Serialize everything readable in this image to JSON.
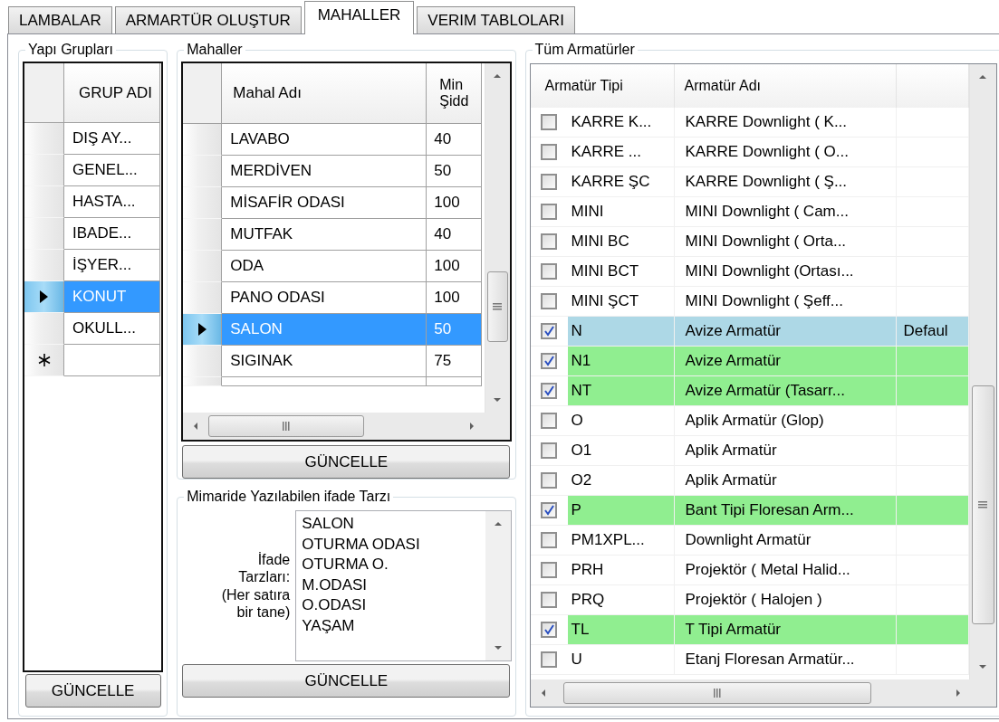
{
  "tabs": [
    {
      "label": "LAMBALAR",
      "selected": false
    },
    {
      "label": "ARMARTÜR OLUŞTUR",
      "selected": false
    },
    {
      "label": "MAHALLER",
      "selected": true
    },
    {
      "label": "VERIM TABLOLARI",
      "selected": false
    }
  ],
  "building_groups": {
    "title": "Yapı Grupları",
    "columns": [
      "GRUP ADI"
    ],
    "rows": [
      {
        "cells": [
          "DIŞ AY..."
        ],
        "selected": false
      },
      {
        "cells": [
          "GENEL..."
        ],
        "selected": false
      },
      {
        "cells": [
          "HASTA..."
        ],
        "selected": false
      },
      {
        "cells": [
          "IBADE..."
        ],
        "selected": false
      },
      {
        "cells": [
          "İŞYER..."
        ],
        "selected": false
      },
      {
        "cells": [
          "KONUT"
        ],
        "selected": true
      },
      {
        "cells": [
          "OKULL..."
        ],
        "selected": false
      }
    ],
    "new_row": true,
    "button": "GÜNCELLE"
  },
  "spaces": {
    "title": "Mahaller",
    "columns": [
      "Mahal Adı",
      "Min\nŞidd"
    ],
    "rows": [
      {
        "cells": [
          "LAVABO",
          "40"
        ],
        "selected": false
      },
      {
        "cells": [
          "MERDİVEN",
          "50"
        ],
        "selected": false
      },
      {
        "cells": [
          "MİSAFİR ODASI",
          "100"
        ],
        "selected": false
      },
      {
        "cells": [
          "MUTFAK",
          "40"
        ],
        "selected": false
      },
      {
        "cells": [
          "ODA",
          "100"
        ],
        "selected": false
      },
      {
        "cells": [
          "PANO ODASI",
          "100"
        ],
        "selected": false
      },
      {
        "cells": [
          "SALON",
          "50"
        ],
        "selected": true
      },
      {
        "cells": [
          "SIGINAK",
          "75"
        ],
        "selected": false
      }
    ],
    "button": "GÜNCELLE"
  },
  "expressions": {
    "title": "Mimaride Yazılabilen ifade Tarzı",
    "label": "İfade\nTarzları:\n(Her satıra\nbir tane)",
    "lines": [
      "SALON",
      "OTURMA ODASI",
      "OTURMA O.",
      "M.ODASI",
      "O.ODASI",
      "YAŞAM"
    ],
    "button": "GÜNCELLE"
  },
  "fixtures": {
    "title": "Tüm Armatürler",
    "columns": [
      "Armatür Tipi",
      "Armatür Adı"
    ],
    "rows": [
      {
        "checked": false,
        "type": "KARRE K...",
        "name": "KARRE Downlight ( K...",
        "color": "#ffffff"
      },
      {
        "checked": false,
        "type": "KARRE ...",
        "name": "KARRE Downlight ( O...",
        "color": "#ffffff"
      },
      {
        "checked": false,
        "type": "KARRE ŞC",
        "name": "KARRE Downlight ( Ş...",
        "color": "#ffffff"
      },
      {
        "checked": false,
        "type": "MINI",
        "name": "MINI Downlight ( Cam...",
        "color": "#ffffff"
      },
      {
        "checked": false,
        "type": "MINI BC",
        "name": "MINI Downlight ( Orta...",
        "color": "#ffffff"
      },
      {
        "checked": false,
        "type": "MINI BCT",
        "name": "MINI Downlight (Ortası...",
        "color": "#ffffff"
      },
      {
        "checked": false,
        "type": "MINI ŞCT",
        "name": "MINI Downlight ( Şeff...",
        "color": "#ffffff"
      },
      {
        "checked": true,
        "type": "N",
        "name": "Avize Armatür",
        "column_3": "Defaul",
        "color": "#add8e6"
      },
      {
        "checked": true,
        "type": "N1",
        "name": "Avize Armatür",
        "color": "#90ee90"
      },
      {
        "checked": true,
        "type": "NT",
        "name": "Avize Armatür (Tasarr...",
        "color": "#90ee90"
      },
      {
        "checked": false,
        "type": "O",
        "name": "Aplik Armatür (Glop)",
        "color": "#ffffff"
      },
      {
        "checked": false,
        "type": "O1",
        "name": "Aplik Armatür",
        "color": "#ffffff"
      },
      {
        "checked": false,
        "type": "O2",
        "name": "Aplik Armatür",
        "color": "#ffffff"
      },
      {
        "checked": true,
        "type": "P",
        "name": "Bant Tipi Floresan Arm...",
        "color": "#90ee90"
      },
      {
        "checked": false,
        "type": "PM1XPL...",
        "name": "Downlight Armatür",
        "color": "#ffffff"
      },
      {
        "checked": false,
        "type": "PRH",
        "name": "Projektör ( Metal Halid...",
        "color": "#ffffff"
      },
      {
        "checked": false,
        "type": "PRQ",
        "name": "Projektör ( Halojen )",
        "color": "#ffffff"
      },
      {
        "checked": true,
        "type": "TL",
        "name": "T Tipi Armatür",
        "color": "#90ee90"
      },
      {
        "checked": false,
        "type": "U",
        "name": "Etanj Floresan Armatür...",
        "color": "#ffffff"
      }
    ]
  }
}
